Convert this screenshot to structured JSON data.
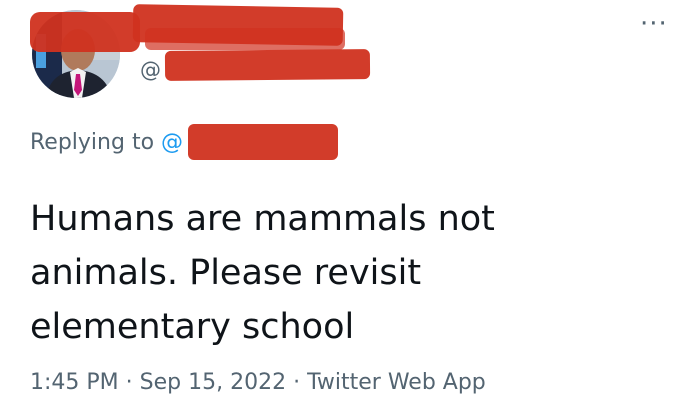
{
  "header": {
    "handle_prefix": "@",
    "more_label": "···"
  },
  "reply": {
    "replying_label": "Replying to ",
    "at_sign": "@"
  },
  "tweet": {
    "lines": [
      "Humans are mammals not",
      "animals. Please revisit",
      "elementary school"
    ]
  },
  "meta": {
    "time": "1:45 PM",
    "separator": "·",
    "date": "Sep 15, 2022",
    "source": "Twitter Web App"
  },
  "colors": {
    "text": "#0f1419",
    "secondary": "#536471",
    "link": "#1d9bf0",
    "redaction": "#d0311f"
  }
}
